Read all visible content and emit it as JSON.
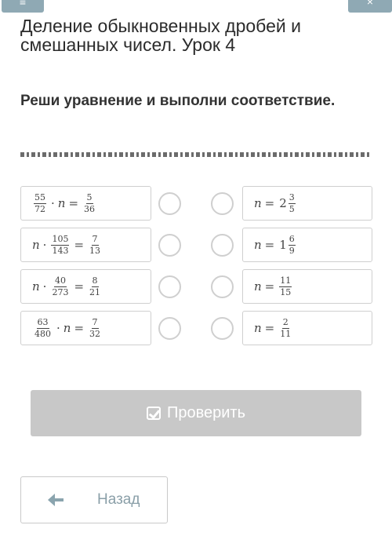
{
  "topbar": {
    "left_glyph": "≡",
    "right_glyph": "×"
  },
  "lesson": {
    "title": "Деление обыкновенных дробей и смешанных чисел. Урок 4"
  },
  "task": {
    "prompt": "Реши уравнение и выполни соответствие."
  },
  "equations": [
    {
      "a_num": "55",
      "a_den": "72",
      "dot": "·",
      "var": "n",
      "eq": "=",
      "b_num": "5",
      "b_den": "36"
    },
    {
      "var": "n",
      "dot": "·",
      "a_num": "105",
      "a_den": "143",
      "eq": "=",
      "b_num": "7",
      "b_den": "13"
    },
    {
      "var": "n",
      "dot": "·",
      "a_num": "40",
      "a_den": "273",
      "eq": "=",
      "b_num": "8",
      "b_den": "21"
    },
    {
      "a_num": "63",
      "a_den": "480",
      "dot": "·",
      "var": "n",
      "eq": "=",
      "b_num": "7",
      "b_den": "32"
    }
  ],
  "answers": [
    {
      "var": "n",
      "eq": "=",
      "whole": "2",
      "num": "3",
      "den": "5"
    },
    {
      "var": "n",
      "eq": "=",
      "whole": "1",
      "num": "6",
      "den": "9"
    },
    {
      "var": "n",
      "eq": "=",
      "num": "11",
      "den": "15"
    },
    {
      "var": "n",
      "eq": "=",
      "num": "2",
      "den": "11"
    }
  ],
  "buttons": {
    "check_label": "Проверить",
    "back_label": "Назад"
  }
}
